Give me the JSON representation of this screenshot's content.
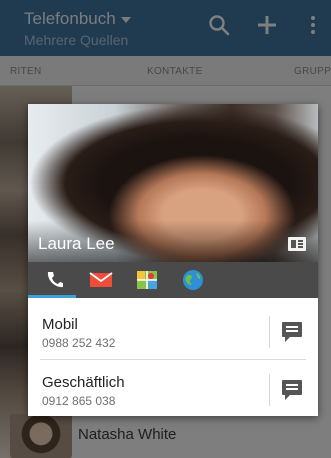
{
  "appbar": {
    "title": "Telefonbuch",
    "subtitle": "Mehrere Quellen",
    "search_icon": "search-icon",
    "add_icon": "plus-icon",
    "menu_icon": "overflow-menu-icon"
  },
  "tabs": {
    "left": "RITEN",
    "center": "KONTAKTE",
    "right": "GRUPP"
  },
  "list": {
    "bottom_contact": "Natasha White"
  },
  "contact_card": {
    "name": "Laura Lee",
    "icons": [
      "phone-icon",
      "mail-icon",
      "map-icon",
      "globe-icon"
    ],
    "accent_color": "#3ea0d8",
    "entries": [
      {
        "label": "Mobil",
        "number": "0988 252 432"
      },
      {
        "label": "Geschäftlich",
        "number": "0912 865 038"
      }
    ]
  },
  "colors": {
    "appbar": "#3e6f9a",
    "icon_bar": "#4a4a4a"
  }
}
